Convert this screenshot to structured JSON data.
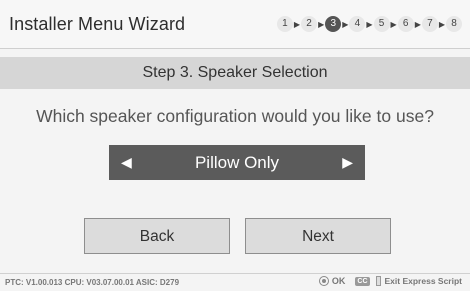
{
  "header": {
    "title": "Installer Menu Wizard",
    "steps": [
      "1",
      "2",
      "3",
      "4",
      "5",
      "6",
      "7",
      "8"
    ],
    "active_step": "3"
  },
  "step_bar": {
    "label": "Step 3. Speaker Selection"
  },
  "question": "Which speaker configuration would you like to use?",
  "selector": {
    "value": "Pillow Only",
    "left_arrow": "◀",
    "right_arrow": "▶"
  },
  "buttons": {
    "back": "Back",
    "next": "Next"
  },
  "footer": {
    "version": "PTC: V1.00.013 CPU: V03.07.00.01 ASIC: D279",
    "ok_label": "OK",
    "cc_label": "CC",
    "exit_label": "Exit Express Script"
  },
  "colors": {
    "selector_bg": "#5b5b5b",
    "step_bar_bg": "#d6d6d6",
    "active_step_bg": "#555555"
  }
}
